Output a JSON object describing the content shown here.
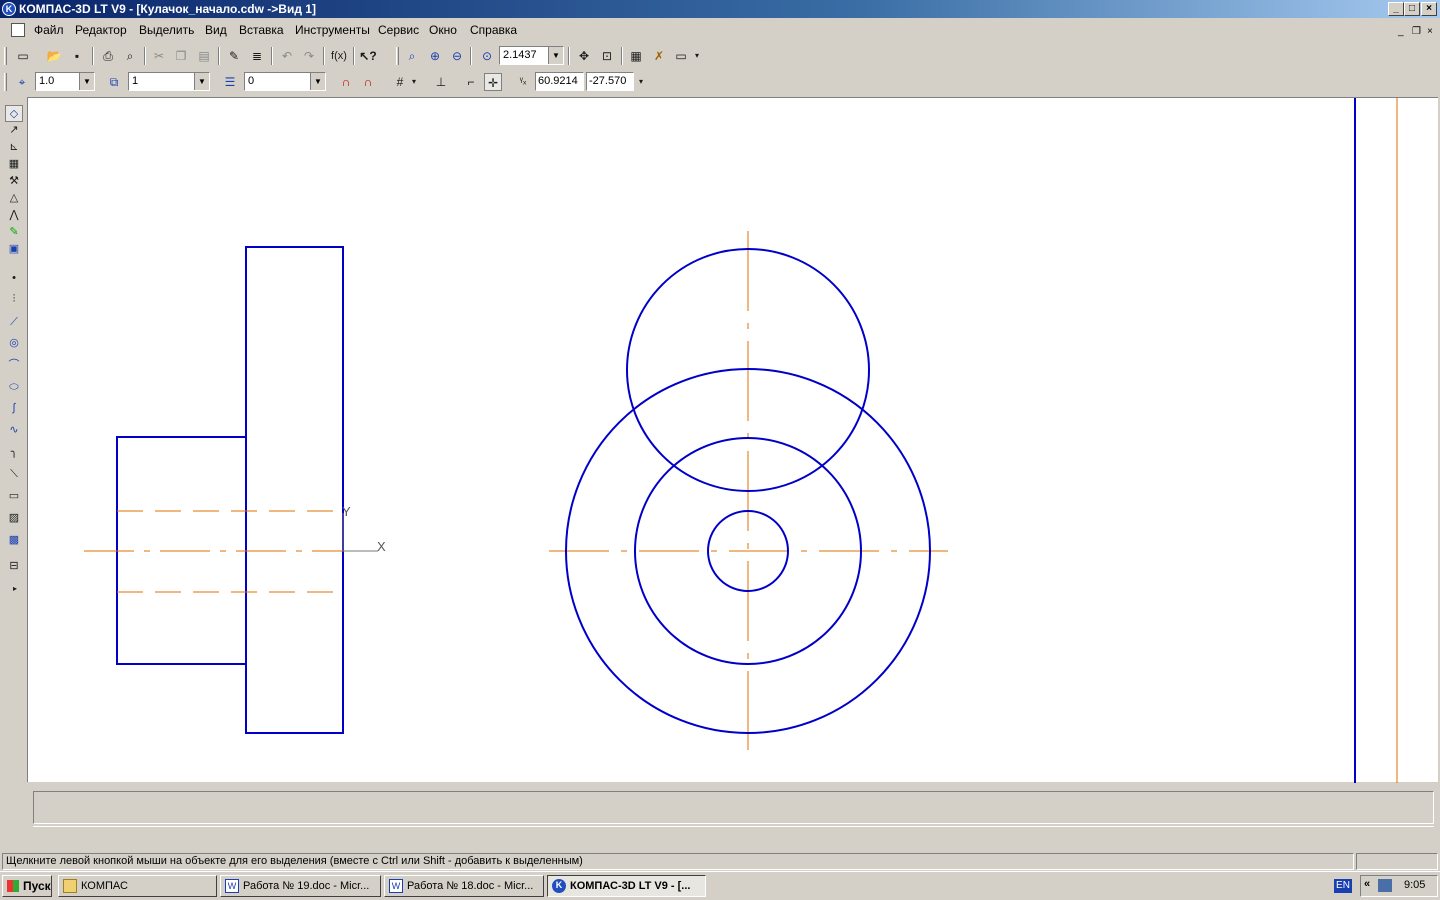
{
  "window": {
    "title": "КОМПАС-3D LT V9 - [Кулачок_начало.cdw ->Вид 1]",
    "app_icon": "kompas-logo",
    "controls": {
      "minimize": "_",
      "maximize": "□",
      "close": "×"
    },
    "mdi_controls": {
      "minimize": "_",
      "restore": "❐",
      "close": "×"
    }
  },
  "menu": [
    "Файл",
    "Редактор",
    "Выделить",
    "Вид",
    "Вставка",
    "Инструменты",
    "Сервис",
    "Окно",
    "Справка"
  ],
  "toolbar_standard": {
    "zoom_value": "2.1437",
    "icons": [
      "new-document-icon",
      "open-folder-icon",
      "save-icon",
      "print-icon",
      "print-preview-icon",
      "cut-icon",
      "copy-icon",
      "paste-icon",
      "format-painter-icon",
      "properties-icon",
      "undo-icon",
      "redo-icon",
      "fx-variables-icon",
      "help-pointer-icon",
      "zoom-window-icon",
      "zoom-in-icon",
      "zoom-out-icon",
      "zoom-scale-icon",
      "pan-icon",
      "fit-all-icon",
      "refresh-icon",
      "managers-icon",
      "layout-icon"
    ]
  },
  "toolbar_current": {
    "step_value": "1.0",
    "view_value": "1",
    "layer_value": "0",
    "cursor_x": "60.9214",
    "cursor_y": "-27.570"
  },
  "left_tools": [
    "geometry-icon",
    "dimensions-icon",
    "designations-icon",
    "edit-icon",
    "parametrization-icon",
    "measure-icon",
    "select-icon",
    "spec-icon",
    "associative-views-icon",
    "point-icon",
    "auxiliary-line-icon",
    "segment-icon",
    "circle-icon",
    "arc-icon",
    "ellipse-icon",
    "spline-icon",
    "polyline-icon",
    "fillet-icon",
    "chamfer-icon",
    "rectangle-icon",
    "hatch-icon",
    "fill-icon",
    "macro-icon"
  ],
  "statusbar": {
    "message": "Щелкните левой кнопкой мыши на объекте для его выделения (вместе с Ctrl или Shift - добавить к выделенным)"
  },
  "taskbar": {
    "start": "Пуск",
    "tasks": [
      {
        "label": "КОМПАС",
        "icon": "folder-icon"
      },
      {
        "label": "Работа № 19.doc - Micr...",
        "icon": "word-icon"
      },
      {
        "label": "Работа № 18.doc - Micr...",
        "icon": "word-icon"
      },
      {
        "label": "КОМПАС-3D LT V9 - [...",
        "icon": "kompas-icon",
        "active": true
      }
    ],
    "lang": "EN",
    "clock": "9:05"
  },
  "drawing": {
    "axis_labels": {
      "x": "X",
      "y": "Y"
    },
    "line_color": "#0000c8",
    "axis_color": "#e07000"
  }
}
